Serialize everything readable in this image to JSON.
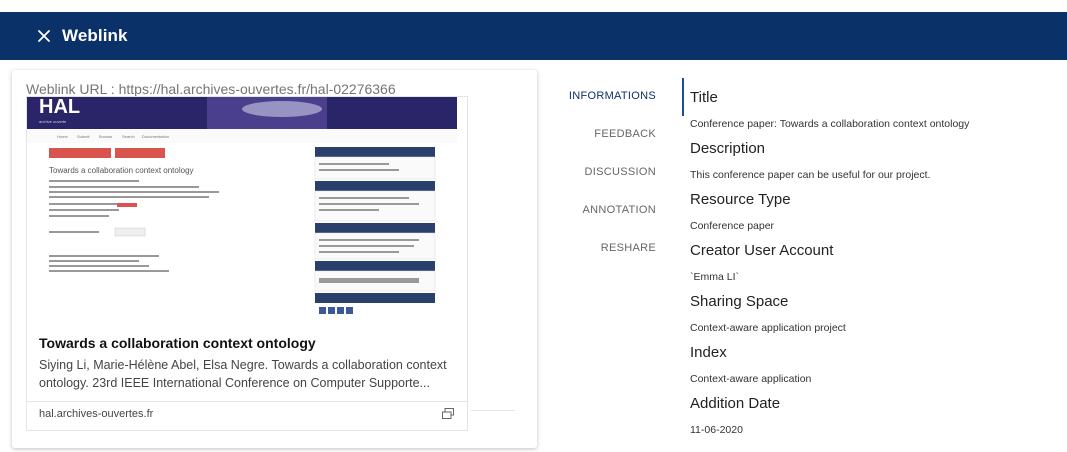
{
  "header": {
    "title": "Weblink",
    "bg_color": "#0b3169"
  },
  "preview": {
    "url_label": "Weblink URL : https://hal.archives-ouvertes.fr/hal-02276366",
    "title": "Towards a collaboration context ontology",
    "description": "Siying Li, Marie-Hélène Abel, Elsa Negre. Towards a collaboration context ontology. 23rd IEEE International Conference on Computer Supporte...",
    "domain": "hal.archives-ouvertes.fr",
    "thumb_title": "Towards a collaboration context ontology",
    "thumb_logo": "HAL"
  },
  "tabs": [
    {
      "label": "INFORMATIONS",
      "active": true
    },
    {
      "label": "FEEDBACK",
      "active": false
    },
    {
      "label": "DISCUSSION",
      "active": false
    },
    {
      "label": "ANNOTATION",
      "active": false
    },
    {
      "label": "RESHARE",
      "active": false
    }
  ],
  "info": {
    "title_label": "Title",
    "title_value": "Conference paper: Towards a collaboration context ontology",
    "description_label": "Description",
    "description_value": "This conference paper can be useful for our project.",
    "resource_type_label": "Resource Type",
    "resource_type_value": "Conference paper",
    "creator_label": "Creator User Account",
    "creator_value": "`Emma LI`",
    "sharing_space_label": "Sharing Space",
    "sharing_space_value": "Context-aware application project",
    "index_label": "Index",
    "index_value": "Context-aware application",
    "addition_date_label": "Addition Date",
    "addition_date_value": "11-06-2020"
  }
}
